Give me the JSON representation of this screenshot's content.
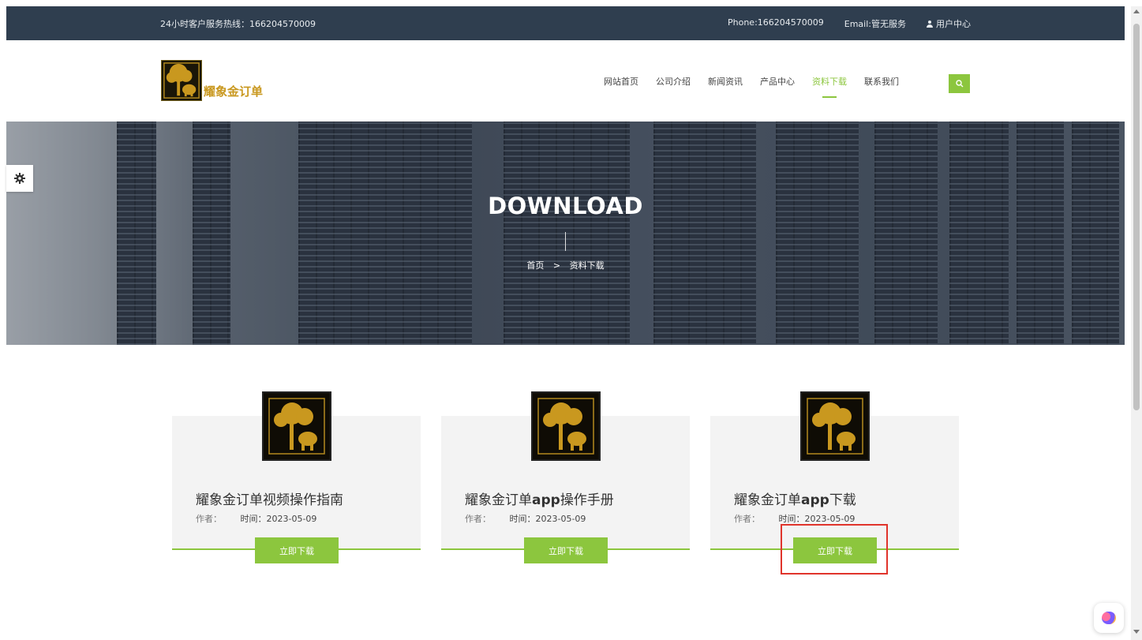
{
  "topbar": {
    "hotline": "24小时客户服务热线：166204570009",
    "phone": "Phone:166204570009",
    "email": "Email:管无服务",
    "user_center": "用户中心"
  },
  "header": {
    "logo_text": "耀象金订单",
    "nav": [
      "网站首页",
      "公司介绍",
      "新闻资讯",
      "产品中心",
      "资料下载",
      "联系我们"
    ],
    "active_nav_index": 4
  },
  "banner": {
    "title": "DOWNLOAD",
    "breadcrumb_home": "首页",
    "breadcrumb_separator": ">",
    "breadcrumb_current": "资料下载"
  },
  "cards": [
    {
      "title_pre": "耀象金订单视频操作指南",
      "title_bold": "",
      "title_post": "",
      "author_label": "作者：",
      "time_label": "时间：",
      "date": "2023-05-09",
      "button": "立即下载"
    },
    {
      "title_pre": "耀象金订单",
      "title_bold": "app",
      "title_post": "操作手册",
      "author_label": "作者：",
      "time_label": "时间：",
      "date": "2023-05-09",
      "button": "立即下载"
    },
    {
      "title_pre": "耀象金订单",
      "title_bold": "app",
      "title_post": "下载",
      "author_label": "作者：",
      "time_label": "时间：",
      "date": "2023-05-09",
      "button": "立即下载"
    }
  ],
  "colors": {
    "accent": "#8cc63e",
    "topbar_bg": "#2f3e4f",
    "highlight": "#e0342b",
    "logo_gold": "#c9981f"
  },
  "icons": [
    "user-icon",
    "search-icon",
    "gear-icon",
    "brain-icon"
  ]
}
